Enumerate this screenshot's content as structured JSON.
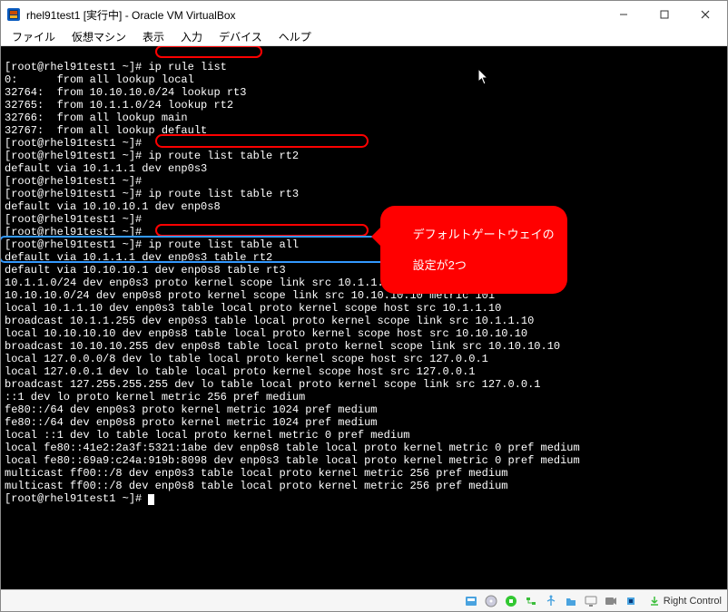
{
  "window": {
    "title": "rhel91test1 [実行中] - Oracle VM VirtualBox"
  },
  "menubar": {
    "items": [
      "ファイル",
      "仮想マシン",
      "表示",
      "入力",
      "デバイス",
      "ヘルプ"
    ]
  },
  "terminal": {
    "prompt": "[root@rhel91test1 ~]#",
    "cmd_ip_rule_list": "ip rule list",
    "rule_0": "0:      from all lookup local",
    "rule_1": "32764:  from 10.10.10.0/24 lookup rt3",
    "rule_2": "32765:  from 10.1.1.0/24 lookup rt2",
    "rule_3": "32766:  from all lookup main",
    "rule_4": "32767:  from all lookup default",
    "cmd_route_rt2": "ip route list table rt2",
    "route_rt2": "default via 10.1.1.1 dev enp0s3",
    "cmd_route_rt3": "ip route list table rt3",
    "route_rt3": "default via 10.10.10.1 dev enp0s8",
    "cmd_route_all": "ip route list table all",
    "route_all": [
      "default via 10.1.1.1 dev enp0s3 table rt2",
      "default via 10.10.10.1 dev enp0s8 table rt3",
      "10.1.1.0/24 dev enp0s3 proto kernel scope link src 10.1.1.10 metric 100",
      "10.10.10.0/24 dev enp0s8 proto kernel scope link src 10.10.10.10 metric 101",
      "local 10.1.1.10 dev enp0s3 table local proto kernel scope host src 10.1.1.10",
      "broadcast 10.1.1.255 dev enp0s3 table local proto kernel scope link src 10.1.1.10",
      "local 10.10.10.10 dev enp0s8 table local proto kernel scope host src 10.10.10.10",
      "broadcast 10.10.10.255 dev enp0s8 table local proto kernel scope link src 10.10.10.10",
      "local 127.0.0.0/8 dev lo table local proto kernel scope host src 127.0.0.1",
      "local 127.0.0.1 dev lo table local proto kernel scope host src 127.0.0.1",
      "broadcast 127.255.255.255 dev lo table local proto kernel scope link src 127.0.0.1",
      "::1 dev lo proto kernel metric 256 pref medium",
      "fe80::/64 dev enp0s3 proto kernel metric 1024 pref medium",
      "fe80::/64 dev enp0s8 proto kernel metric 1024 pref medium",
      "local ::1 dev lo table local proto kernel metric 0 pref medium",
      "local fe80::41e2:2a3f:5321:1abe dev enp0s8 table local proto kernel metric 0 pref medium",
      "local fe80::69a9:c24a:919b:8098 dev enp0s3 table local proto kernel metric 0 pref medium",
      "multicast ff00::/8 dev enp0s3 table local proto kernel metric 256 pref medium",
      "multicast ff00::/8 dev enp0s8 table local proto kernel metric 256 pref medium"
    ]
  },
  "annotations": {
    "callout_line1": "デフォルトゲートウェイの",
    "callout_line2": "設定が2つ"
  },
  "statusbar": {
    "hostkey_label": "Right Control",
    "icons": [
      "disk-icon",
      "cd-icon",
      "audio-icon",
      "network-icon",
      "usb-icon",
      "shared-folder-icon",
      "display-icon",
      "record-icon",
      "cpu-icon"
    ]
  }
}
